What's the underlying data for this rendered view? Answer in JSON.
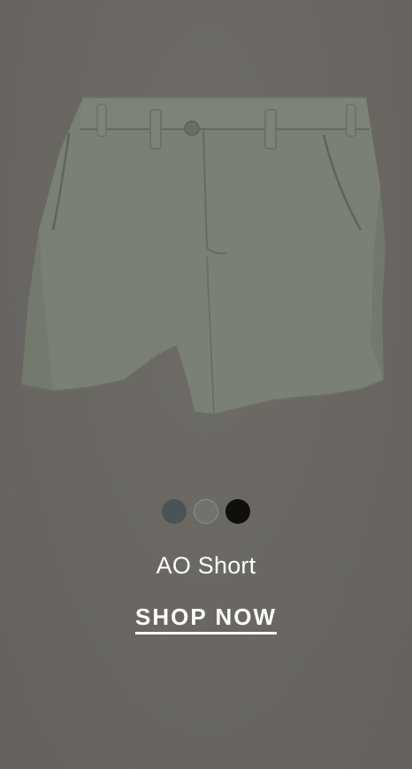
{
  "product": {
    "name": "AO Short",
    "cta_label": "SHOP NOW",
    "image_icon": "shorts-product-image",
    "garment_color": "#7a8073"
  },
  "swatches": [
    {
      "name": "dark-slate",
      "color": "#4b5354",
      "selected": false
    },
    {
      "name": "olive-grey",
      "color": "#6f736c",
      "selected": true
    },
    {
      "name": "black",
      "color": "#0f0f0f",
      "selected": false
    }
  ],
  "colors": {
    "background": "#6b6864",
    "text": "#ffffff"
  }
}
